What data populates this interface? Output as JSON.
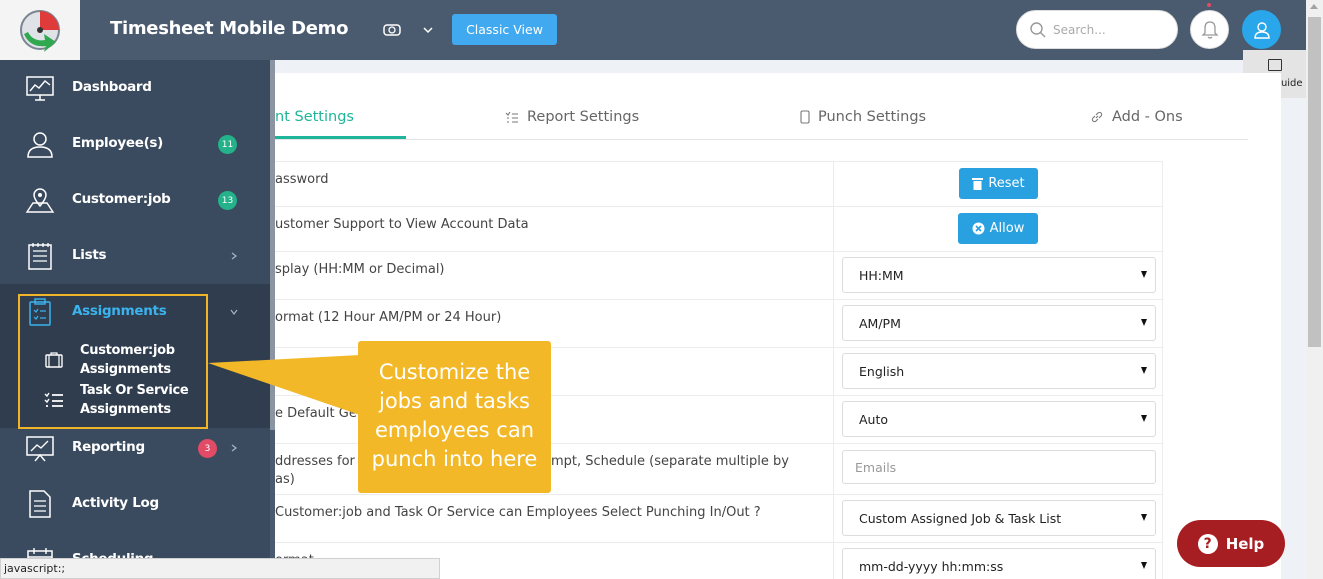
{
  "header": {
    "app_title": "Timesheet Mobile Demo",
    "classic_view_label": "Classic View",
    "search_placeholder": "Search...",
    "currency_icon": "currency-icon",
    "bell_icon": "bell-icon",
    "user_icon": "user-icon"
  },
  "page_guide": {
    "label": "page guide"
  },
  "tabs": [
    {
      "label": "nt Settings",
      "active": true
    },
    {
      "label": "Report Settings",
      "icon": "list-icon"
    },
    {
      "label": "Punch Settings",
      "icon": "phone-icon"
    },
    {
      "label": "Add - Ons",
      "icon": "link-icon"
    }
  ],
  "settings": [
    {
      "label": "assword",
      "control": "button",
      "value": "Reset",
      "icon": "trash-icon"
    },
    {
      "label": "ustomer Support to View Account Data",
      "control": "button",
      "value": "Allow",
      "icon": "x-circle-icon"
    },
    {
      "label": "splay (HH:MM or Decimal)",
      "control": "select",
      "value": "HH:MM"
    },
    {
      "label": "ormat (12 Hour AM/PM or 24 Hour)",
      "control": "select",
      "value": "AM/PM"
    },
    {
      "label": "",
      "control": "select",
      "value": "English"
    },
    {
      "label": "e Default Ge",
      "control": "select",
      "value": "Auto"
    },
    {
      "label": "ddresses for",
      "label_right": "mpt, Schedule (separate multiple by",
      "label_line2": "as)",
      "control": "input",
      "placeholder": "Emails"
    },
    {
      "label": "Customer:job and Task Or Service can Employees Select Punching In/Out ?",
      "control": "select",
      "value": "Custom Assigned Job & Task List"
    },
    {
      "label": "ormat",
      "control": "select",
      "value": "mm-dd-yyyy hh:mm:ss"
    }
  ],
  "sidebar": {
    "items": [
      {
        "label": "Dashboard",
        "icon": "dashboard-icon"
      },
      {
        "label": "Employee(s)",
        "icon": "employees-icon",
        "badge": "11"
      },
      {
        "label": "Customer:job",
        "icon": "map-pin-icon",
        "badge": "13"
      },
      {
        "label": "Lists",
        "icon": "lists-icon"
      },
      {
        "label": "Assignments",
        "icon": "clipboard-icon",
        "active": true
      },
      {
        "label": "Reporting",
        "icon": "chart-icon",
        "badge": "3"
      },
      {
        "label": "Activity Log",
        "icon": "document-icon"
      },
      {
        "label": "Scheduling",
        "icon": "calendar-icon"
      }
    ],
    "sub_items": [
      {
        "line1": "Customer:job",
        "line2": "Assignments",
        "icon": "briefcase-icon"
      },
      {
        "line1": "Task Or Service",
        "line2": "Assignments",
        "icon": "task-list-icon"
      }
    ]
  },
  "callout": {
    "lines": [
      "Customize the",
      "jobs and tasks",
      "employees can",
      "punch into here"
    ]
  },
  "help": {
    "label": "Help"
  },
  "status_bar": {
    "text": "javascript:;"
  },
  "colors": {
    "topbar": "#4a5a6f",
    "sidebar": "#3b4b5f",
    "accent": "#1fb59a",
    "callout": "#f2b827",
    "help": "#a71e22"
  }
}
